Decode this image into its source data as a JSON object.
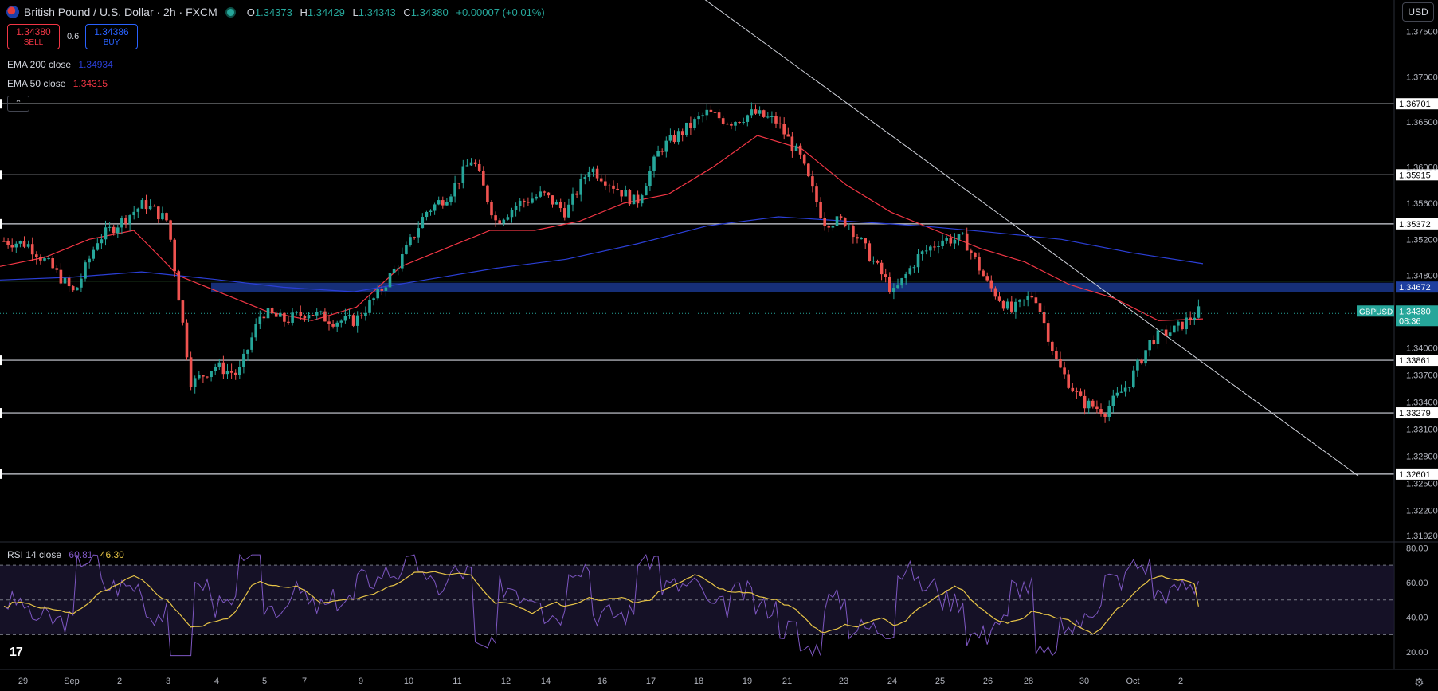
{
  "header": {
    "title": "British Pound / U.S. Dollar · 2h · FXCM",
    "ohlc": {
      "o": "1.34373",
      "h": "1.34429",
      "l": "1.34343",
      "c": "1.34380",
      "chg": "+0.00007 (+0.01%)"
    }
  },
  "trade": {
    "sell_price": "1.34380",
    "sell_label": "SELL",
    "buy_price": "1.34386",
    "buy_label": "BUY",
    "spread": "0.6"
  },
  "indicators": {
    "ema200": {
      "label": "EMA 200 close",
      "value": "1.34934",
      "color": "#2b3fd6"
    },
    "ema50": {
      "label": "EMA 50 close",
      "value": "1.34315",
      "color": "#f23645"
    },
    "rsi": {
      "label": "RSI 14 close",
      "value": "60.81",
      "ma_value": "46.30",
      "color": "#7e57c2",
      "ma_color": "#e8c547"
    }
  },
  "currency": "USD",
  "collapse_icon": "chevron-up-icon",
  "chart_data": {
    "type": "candlestick",
    "symbol": "GBPUSD",
    "interval": "2h",
    "last_price": "1.34380",
    "countdown": "08:36",
    "y_range": [
      1.3185,
      1.3785
    ],
    "price_ticks": [
      "1.37500",
      "1.37000",
      "1.36500",
      "1.36000",
      "1.35600",
      "1.35200",
      "1.34800",
      "1.34000",
      "1.33700",
      "1.33400",
      "1.33100",
      "1.32800",
      "1.32500",
      "1.32200",
      "1.31920"
    ],
    "horizontal_levels": [
      {
        "price": 1.36701,
        "label": "1.36701"
      },
      {
        "price": 1.35915,
        "label": "1.35915"
      },
      {
        "price": 1.35372,
        "label": "1.35372"
      },
      {
        "price": 1.33861,
        "label": "1.33861"
      },
      {
        "price": 1.33279,
        "label": "1.33279"
      },
      {
        "price": 1.32601,
        "label": "1.32601"
      }
    ],
    "zone": {
      "top": 1.3472,
      "bottom": 1.3462,
      "label": "1.34672"
    },
    "x_labels": [
      "29",
      "Sep",
      "2",
      "3",
      "4",
      "5",
      "7",
      "9",
      "10",
      "11",
      "12",
      "14",
      "16",
      "17",
      "18",
      "19",
      "21",
      "23",
      "24",
      "25",
      "26",
      "28",
      "30",
      "Oct",
      "2"
    ],
    "x_label_pos": [
      29,
      90,
      150,
      211,
      272,
      332,
      382,
      453,
      513,
      574,
      635,
      685,
      756,
      817,
      877,
      938,
      988,
      1059,
      1120,
      1180,
      1240,
      1291,
      1361,
      1422,
      1482
    ],
    "trendline": [
      [
        1.3795,
        870
      ],
      [
        1.3258,
        1705
      ]
    ],
    "price_path": [
      1.3518,
      1.3515,
      1.349,
      1.346,
      1.352,
      1.354,
      1.356,
      1.354,
      1.336,
      1.338,
      1.337,
      1.344,
      1.343,
      1.344,
      1.343,
      1.343,
      1.346,
      1.35,
      1.355,
      1.357,
      1.361,
      1.354,
      1.356,
      1.357,
      1.355,
      1.36,
      1.358,
      1.356,
      1.362,
      1.364,
      1.366,
      1.365,
      1.366,
      1.365,
      1.361,
      1.354,
      1.354,
      1.35,
      1.346,
      1.35,
      1.352,
      1.352,
      1.347,
      1.344,
      1.346,
      1.338,
      1.334,
      1.333,
      1.336,
      1.341,
      1.342,
      1.344
    ],
    "ema50_path": [
      1.349,
      1.35,
      1.352,
      1.353,
      1.348,
      1.346,
      1.344,
      1.343,
      1.3445,
      1.349,
      1.351,
      1.353,
      1.353,
      1.354,
      1.356,
      1.357,
      1.36,
      1.3635,
      1.362,
      1.358,
      1.355,
      1.353,
      1.351,
      1.3495,
      1.347,
      1.3455,
      1.343,
      1.3432
    ],
    "ema200_path": [
      1.3475,
      1.3478,
      1.3484,
      1.3476,
      1.3467,
      1.3462,
      1.3475,
      1.3488,
      1.3498,
      1.3515,
      1.3535,
      1.3545,
      1.354,
      1.3535,
      1.3528,
      1.352,
      1.3505,
      1.3493
    ],
    "rsi": {
      "y_ticks": [
        "80.00",
        "60.00",
        "40.00",
        "20.00"
      ],
      "levels": [
        70,
        50,
        30
      ],
      "current": 60.81,
      "ma": 46.3
    }
  }
}
